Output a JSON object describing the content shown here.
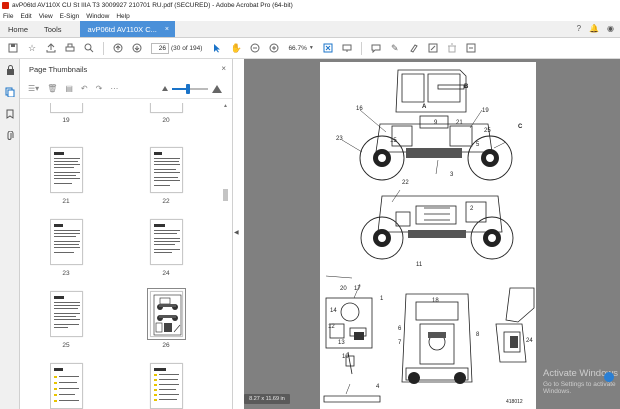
{
  "window": {
    "title": "avP06td AV110X CU St IIIA T3 3009927 210701 RU.pdf (SECURED) - Adobe Acrobat Pro (64-bit)"
  },
  "menu": [
    "File",
    "Edit",
    "View",
    "E-Sign",
    "Window",
    "Help"
  ],
  "tabs": {
    "home": "Home",
    "tools": "Tools",
    "document": "avP06td AV110X C...",
    "close_glyph": "×"
  },
  "toolbar": {
    "current_page": "26",
    "page_count": "(30 of 194)",
    "zoom": "66.7%"
  },
  "thumbnails_panel": {
    "title": "Page Thumbnails",
    "close_glyph": "×",
    "slider_fraction": 0.45,
    "pages": [
      "19",
      "20",
      "21",
      "22",
      "23",
      "24",
      "25",
      "26"
    ],
    "selected_page": "26"
  },
  "viewer": {
    "page_size_label": "8.27 x 11.69 in",
    "drawing_id": "418012",
    "callouts": [
      "16",
      "B",
      "A",
      "23",
      "22",
      "C",
      "3",
      "15",
      "9",
      "19",
      "21",
      "25",
      "5",
      "2",
      "11",
      "13",
      "12",
      "6",
      "7",
      "4",
      "8",
      "24",
      "20",
      "17",
      "14",
      "10",
      "1",
      "18"
    ]
  },
  "watermark": {
    "line1": "Activate Windows",
    "line2": "Go to Settings to activate Windows."
  },
  "colors": {
    "accent": "#1a73c8",
    "tab_active": "#4a90d9",
    "viewer_bg": "#808080",
    "app_red": "#d81e05"
  }
}
